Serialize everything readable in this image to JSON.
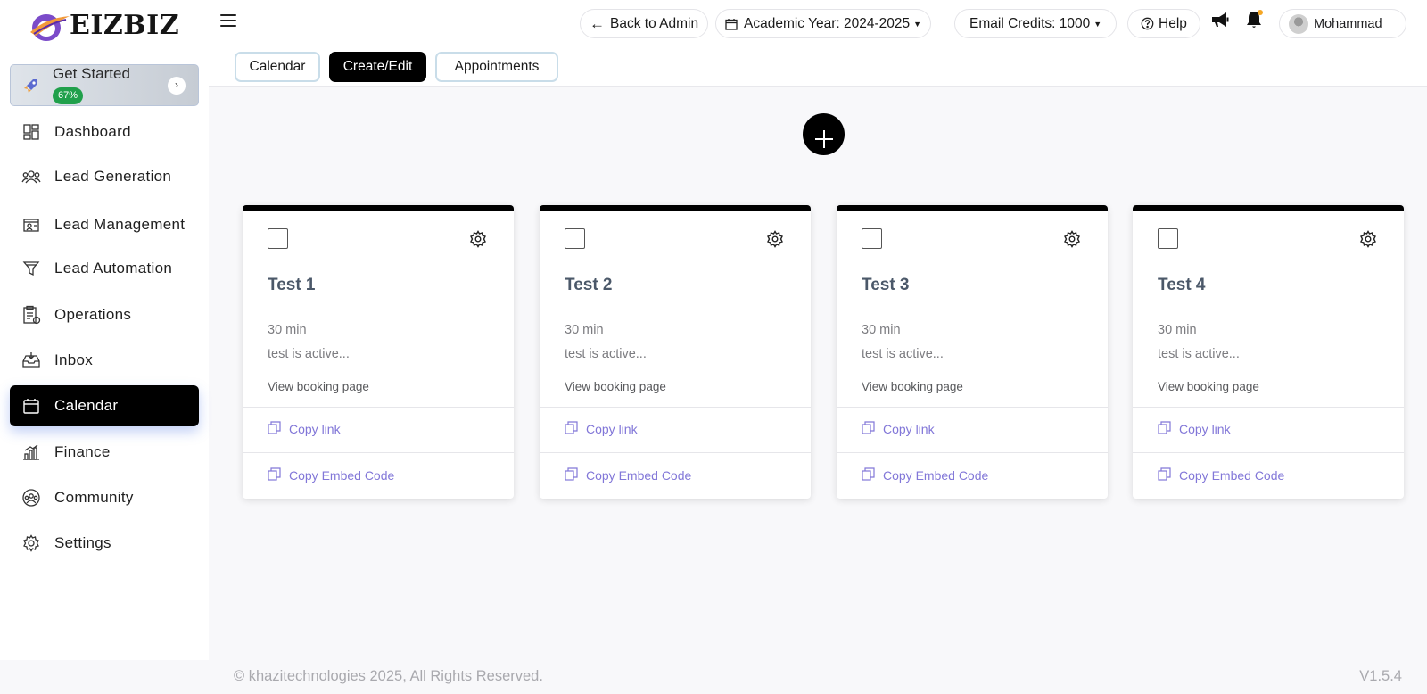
{
  "brand": {
    "name": "EIZBIZ"
  },
  "sidebar": {
    "get_started": {
      "label": "Get Started",
      "progress": "67%"
    },
    "items": [
      {
        "label": "Dashboard",
        "icon": "dashboard-icon"
      },
      {
        "label": "Lead Generation",
        "icon": "users-group-icon"
      },
      {
        "label": "Lead Management",
        "icon": "id-card-icon"
      },
      {
        "label": "Lead Automation",
        "icon": "funnel-icon"
      },
      {
        "label": "Operations",
        "icon": "clipboard-icon"
      },
      {
        "label": "Inbox",
        "icon": "inbox-icon"
      },
      {
        "label": "Calendar",
        "icon": "calendar-icon",
        "active": true
      },
      {
        "label": "Finance",
        "icon": "chart-bars-icon"
      },
      {
        "label": "Community",
        "icon": "community-icon"
      },
      {
        "label": "Settings",
        "icon": "gear-icon"
      }
    ]
  },
  "header": {
    "back_label": "Back to Admin",
    "academic_year": "Academic Year: 2024-2025",
    "email_credits": "Email Credits: 1000",
    "help_label": "Help",
    "user_name": "Mohammad"
  },
  "tabs": [
    {
      "label": "Calendar"
    },
    {
      "label": "Create/Edit",
      "active": true
    },
    {
      "label": "Appointments"
    }
  ],
  "cards": [
    {
      "title": "Test 1",
      "duration": "30 min",
      "description": "test is active...",
      "view_label": "View booking page",
      "copy_link": "Copy link",
      "copy_embed": "Copy Embed Code"
    },
    {
      "title": "Test 2",
      "duration": "30 min",
      "description": "test is active...",
      "view_label": "View booking page",
      "copy_link": "Copy link",
      "copy_embed": "Copy Embed Code"
    },
    {
      "title": "Test 3",
      "duration": "30 min",
      "description": "test is active...",
      "view_label": "View booking page",
      "copy_link": "Copy link",
      "copy_embed": "Copy Embed Code"
    },
    {
      "title": "Test 4",
      "duration": "30 min",
      "description": "test is active...",
      "view_label": "View booking page",
      "copy_link": "Copy link",
      "copy_embed": "Copy Embed Code"
    }
  ],
  "footer": {
    "copyright": "© khazitechnologies 2025, All Rights Reserved.",
    "version": "V1.5.4"
  },
  "colors": {
    "accent_link": "#8277d8",
    "progress_badge": "#20a04b",
    "active_nav": "#000000",
    "notification_dot": "#f5a623"
  }
}
